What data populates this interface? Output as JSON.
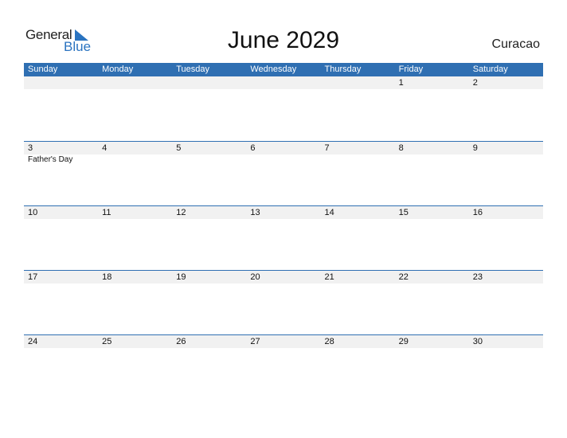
{
  "logo": {
    "line1": "General",
    "line2": "Blue"
  },
  "title": "June 2029",
  "country": "Curacao",
  "weekdays": [
    "Sunday",
    "Monday",
    "Tuesday",
    "Wednesday",
    "Thursday",
    "Friday",
    "Saturday"
  ],
  "weeks": [
    {
      "days": [
        "",
        "",
        "",
        "",
        "",
        "1",
        "2"
      ],
      "events": [
        "",
        "",
        "",
        "",
        "",
        "",
        ""
      ]
    },
    {
      "days": [
        "3",
        "4",
        "5",
        "6",
        "7",
        "8",
        "9"
      ],
      "events": [
        "Father's Day",
        "",
        "",
        "",
        "",
        "",
        ""
      ]
    },
    {
      "days": [
        "10",
        "11",
        "12",
        "13",
        "14",
        "15",
        "16"
      ],
      "events": [
        "",
        "",
        "",
        "",
        "",
        "",
        ""
      ]
    },
    {
      "days": [
        "17",
        "18",
        "19",
        "20",
        "21",
        "22",
        "23"
      ],
      "events": [
        "",
        "",
        "",
        "",
        "",
        "",
        ""
      ]
    },
    {
      "days": [
        "24",
        "25",
        "26",
        "27",
        "28",
        "29",
        "30"
      ],
      "events": [
        "",
        "",
        "",
        "",
        "",
        "",
        ""
      ]
    }
  ]
}
